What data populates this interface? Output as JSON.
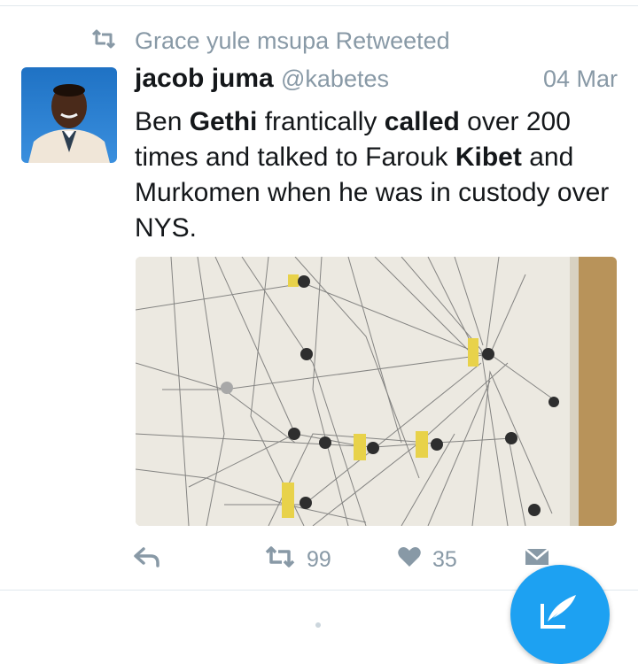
{
  "retweet": {
    "icon": "retweet-icon",
    "text": "Grace yule msupa Retweeted"
  },
  "tweet": {
    "author_name": "jacob juma",
    "author_handle": "@kabetes",
    "date": "04 Mar",
    "text_segments": [
      {
        "text": "Ben ",
        "bold": false
      },
      {
        "text": "Gethi",
        "bold": true
      },
      {
        "text": " frantically ",
        "bold": false
      },
      {
        "text": "called",
        "bold": true
      },
      {
        "text": " over 200 times and talked to Farouk ",
        "bold": false
      },
      {
        "text": "Kibet",
        "bold": true
      },
      {
        "text": " and Murkomen when he was in custody over NYS.",
        "bold": false
      }
    ],
    "media": {
      "kind": "photo",
      "description_icon": "network-diagram-photo"
    }
  },
  "actions": {
    "reply": {
      "icon": "reply-icon"
    },
    "retweet": {
      "icon": "retweet-icon",
      "count": "99"
    },
    "like": {
      "icon": "heart-icon",
      "count": "35"
    },
    "message": {
      "icon": "envelope-icon"
    }
  },
  "compose": {
    "icon": "compose-tweet-icon"
  },
  "colors": {
    "accent": "#1da1f2",
    "muted": "#8899a6",
    "text": "#14171a"
  }
}
